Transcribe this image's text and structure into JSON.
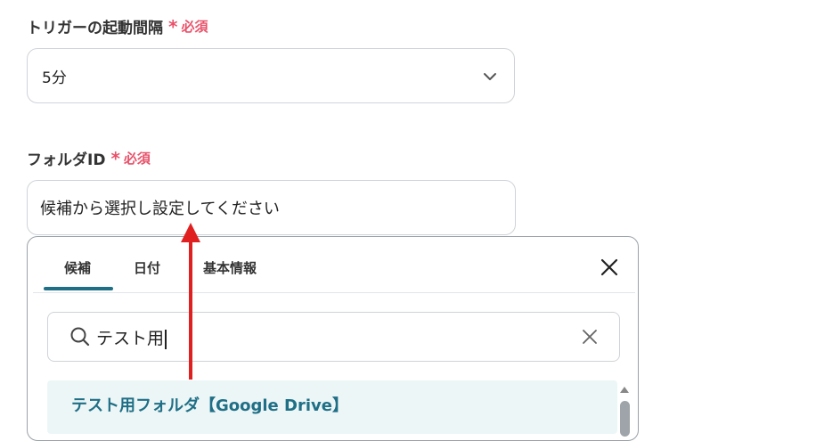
{
  "trigger_interval": {
    "label": "トリガーの起動間隔",
    "required_text": "必須",
    "selected_value": "5分"
  },
  "folder_id": {
    "label": "フォルダID",
    "required_text": "必須",
    "placeholder": "候補から選択し設定してください"
  },
  "candidate_panel": {
    "tabs": [
      {
        "label": "候補",
        "active": true
      },
      {
        "label": "日付",
        "active": false
      },
      {
        "label": "基本情報",
        "active": false
      }
    ],
    "search_value": "テスト用",
    "results": [
      {
        "label": "テスト用フォルダ【Google Drive】"
      }
    ]
  },
  "colors": {
    "required": "#e8526a",
    "accent": "#1f6f86",
    "result_highlight": "#edf6f7",
    "annotation_arrow": "#e02020"
  },
  "icons": {
    "select": "chevron-down-icon",
    "close": "close-icon",
    "search": "search-icon",
    "clear": "clear-icon",
    "scroll": "scroll-up-icon"
  }
}
